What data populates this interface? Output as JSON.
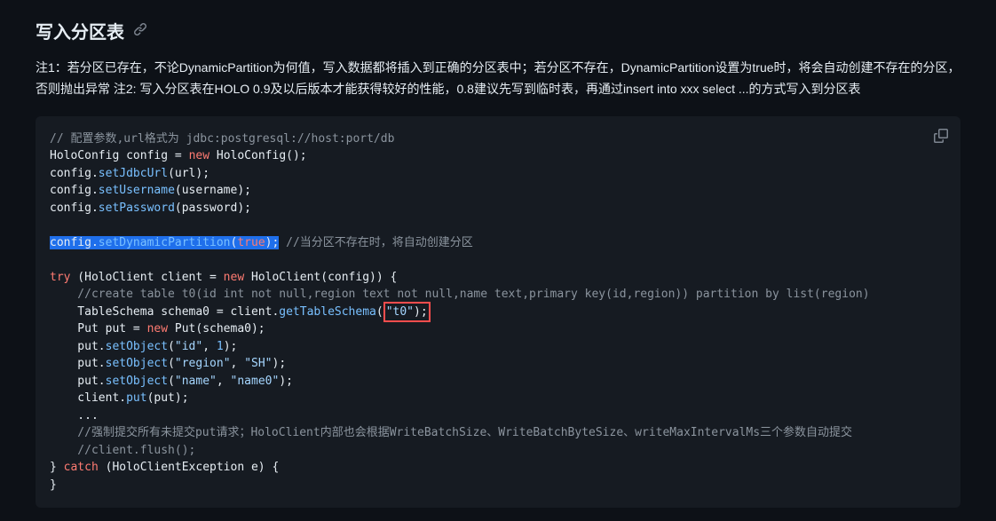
{
  "heading": "写入分区表",
  "description": "注1：若分区已存在，不论DynamicPartition为何值，写入数据都将插入到正确的分区表中；若分区不存在，DynamicPartition设置为true时，将会自动创建不存在的分区，否则抛出异常 注2: 写入分区表在HOLO 0.9及以后版本才能获得较好的性能，0.8建议先写到临时表，再通过insert into xxx select ...的方式写入到分区表",
  "code": {
    "l1": "// 配置参数,url格式为 jdbc:postgresql://host:port/db",
    "l2a": "HoloConfig",
    "l2b": "config",
    "l2c": "new",
    "l2d": "HoloConfig",
    "l3a": "config.",
    "l3b": "setJdbcUrl",
    "l3c": "(url);",
    "l4a": "config.",
    "l4b": "setUsername",
    "l4c": "(username);",
    "l5a": "config.",
    "l5b": "setPassword",
    "l5c": "(password);",
    "l6a": "config.",
    "l6b": "setDynamicPartition",
    "l6c": "(",
    "l6d": "true",
    "l6e": ");",
    "l6f": " //当分区不存在时，将自动创建分区",
    "l7a": "try",
    "l7b": " (HoloClient client = ",
    "l7c": "new",
    "l7d": " HoloClient(config)) {",
    "l8": "    //create table t0(id int not null,region text not null,name text,primary key(id,region)) partition by list(region)",
    "l9a": "    TableSchema schema0 = client.",
    "l9b": "getTableSchema",
    "l9c": "(",
    "l9d": "\"t0\"",
    "l9e": ");",
    "l10a": "    Put put = ",
    "l10b": "new",
    "l10c": " Put(schema0);",
    "l11a": "    put.",
    "l11b": "setObject",
    "l11c": "(",
    "l11d": "\"id\"",
    "l11e": ", ",
    "l11f": "1",
    "l11g": ");",
    "l12a": "    put.",
    "l12b": "setObject",
    "l12c": "(",
    "l12d": "\"region\"",
    "l12e": ", ",
    "l12f": "\"SH\"",
    "l12g": ");",
    "l13a": "    put.",
    "l13b": "setObject",
    "l13c": "(",
    "l13d": "\"name\"",
    "l13e": ", ",
    "l13f": "\"name0\"",
    "l13g": ");",
    "l14a": "    client.",
    "l14b": "put",
    "l14c": "(put);",
    "l15": "    ...",
    "l16": "    //强制提交所有未提交put请求；HoloClient内部也会根据WriteBatchSize、WriteBatchByteSize、writeMaxIntervalMs三个参数自动提交",
    "l17": "    //client.flush();",
    "l18a": "} ",
    "l18b": "catch",
    "l18c": " (HoloClientException e) {",
    "l19": "}"
  }
}
